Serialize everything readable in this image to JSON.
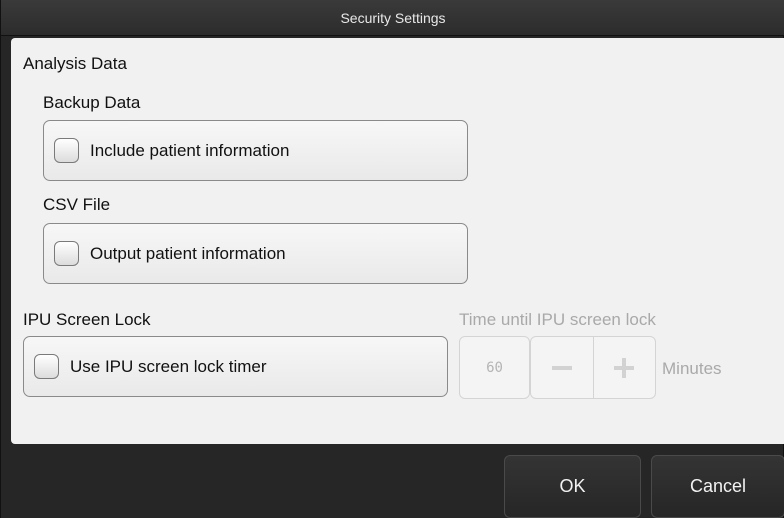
{
  "window": {
    "title": "Security Settings"
  },
  "analysis_data": {
    "title": "Analysis Data",
    "backup": {
      "title": "Backup Data",
      "option_label": "Include patient information",
      "checked": false
    },
    "csv": {
      "title": "CSV File",
      "option_label": "Output patient information",
      "checked": false
    }
  },
  "screen_lock": {
    "title": "IPU Screen Lock",
    "option_label": "Use IPU screen lock timer",
    "checked": false,
    "timer": {
      "title": "Time until IPU screen lock",
      "value": "60",
      "unit": "Minutes",
      "enabled": false
    }
  },
  "footer": {
    "ok_label": "OK",
    "cancel_label": "Cancel"
  }
}
